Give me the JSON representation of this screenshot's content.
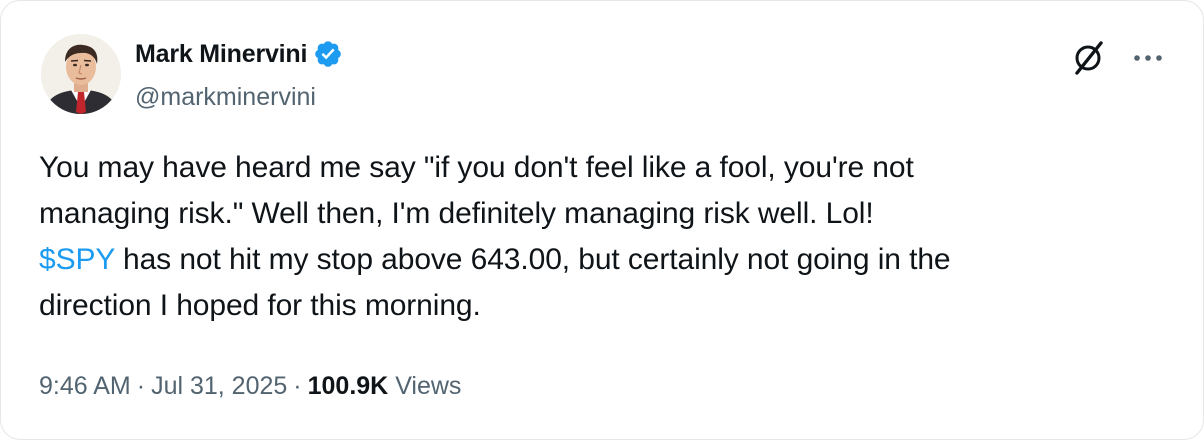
{
  "author": {
    "display_name": "Mark Minervini",
    "handle": "@markminervini",
    "verified": true,
    "verified_color": "#1d9bf0"
  },
  "header_actions": {
    "grok_icon": "grok-icon",
    "more_icon": "more-icon"
  },
  "tweet": {
    "line1": "You may have heard me say \"if you don't feel like a fool, you're not",
    "line2": "managing risk.\"  Well then, I'm definitely managing risk well. Lol!",
    "cashtag": "$SPY",
    "line3_rest": " has not hit my stop above 643.00, but certainly not going in the",
    "line4": "direction I hoped for this morning.",
    "cashtag_color": "#1d9bf0"
  },
  "meta": {
    "time": "9:46 AM",
    "separator": "·",
    "date": "Jul 31, 2025",
    "views_count": "100.9K",
    "views_label": "Views"
  }
}
